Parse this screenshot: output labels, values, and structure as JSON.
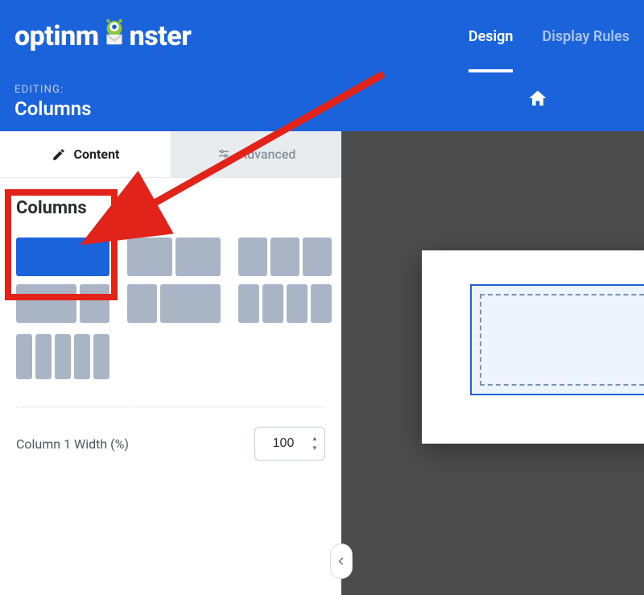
{
  "brand": {
    "name_pre": "optinm",
    "name_post": "nster"
  },
  "topTabs": {
    "design": "Design",
    "displayRules": "Display Rules"
  },
  "subheader": {
    "editingLabel": "EDITING:",
    "editingTitle": "Columns"
  },
  "panelTabs": {
    "content": "Content",
    "advanced": "Advanced"
  },
  "section": {
    "title": "Columns"
  },
  "widthRow": {
    "label": "Column 1 Width (%)",
    "value": "100"
  }
}
